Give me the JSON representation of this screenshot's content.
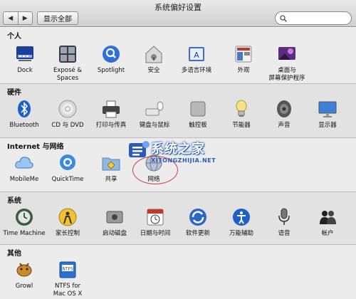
{
  "window": {
    "title": "系统偏好设置"
  },
  "toolbar": {
    "back_glyph": "◀",
    "forward_glyph": "▶",
    "show_all_label": "显示全部",
    "search_value": "",
    "search_icon": "search-icon"
  },
  "sections": [
    {
      "title": "个人",
      "items": [
        {
          "label": "Dock",
          "icon": "dock-icon"
        },
        {
          "label": "Exposé &",
          "label2": "Spaces",
          "icon": "expose-spaces-icon"
        },
        {
          "label": "Spotlight",
          "icon": "spotlight-icon"
        },
        {
          "label": "安全",
          "icon": "security-icon"
        },
        {
          "label": "多语言环境",
          "icon": "language-icon"
        },
        {
          "label": "外观",
          "icon": "appearance-icon"
        },
        {
          "label": "桌面与",
          "label2": "屏幕保护程序",
          "icon": "desktop-screensaver-icon"
        }
      ]
    },
    {
      "title": "硬件",
      "items": [
        {
          "label": "Bluetooth",
          "icon": "bluetooth-icon"
        },
        {
          "label": "CD 与 DVD",
          "icon": "cd-dvd-icon"
        },
        {
          "label": "打印与传真",
          "icon": "print-fax-icon"
        },
        {
          "label": "键盘与鼠标",
          "icon": "keyboard-mouse-icon"
        },
        {
          "label": "触控板",
          "icon": "trackpad-icon"
        },
        {
          "label": "节能器",
          "icon": "energy-saver-icon"
        },
        {
          "label": "声音",
          "icon": "sound-icon"
        },
        {
          "label": "显示器",
          "icon": "displays-icon"
        }
      ]
    },
    {
      "title": "Internet 与网络",
      "items": [
        {
          "label": "MobileMe",
          "icon": "mobileme-icon"
        },
        {
          "label": "QuickTime",
          "icon": "quicktime-icon"
        },
        {
          "label": "共享",
          "icon": "sharing-icon"
        },
        {
          "label": "网络",
          "icon": "network-icon"
        }
      ]
    },
    {
      "title": "系统",
      "items": [
        {
          "label": "Time Machine",
          "icon": "time-machine-icon"
        },
        {
          "label": "家长控制",
          "icon": "parental-controls-icon"
        },
        {
          "label": "启动磁盘",
          "icon": "startup-disk-icon"
        },
        {
          "label": "日期与时间",
          "icon": "date-time-icon"
        },
        {
          "label": "软件更新",
          "icon": "software-update-icon"
        },
        {
          "label": "万能辅助",
          "icon": "universal-access-icon"
        },
        {
          "label": "语音",
          "icon": "speech-icon"
        },
        {
          "label": "帐户",
          "icon": "accounts-icon"
        }
      ]
    },
    {
      "title": "其他",
      "items": [
        {
          "label": "Growl",
          "icon": "growl-icon"
        },
        {
          "label": "NTFS for",
          "label2": "Mac OS X",
          "icon": "ntfs-icon"
        }
      ]
    }
  ],
  "watermark": {
    "title": "系统之家",
    "subtitle": "XITONGZHIJIA.NET"
  },
  "colors": {
    "accent_blue": "#1f5fc8",
    "highlight_ring": "#c9403a"
  }
}
